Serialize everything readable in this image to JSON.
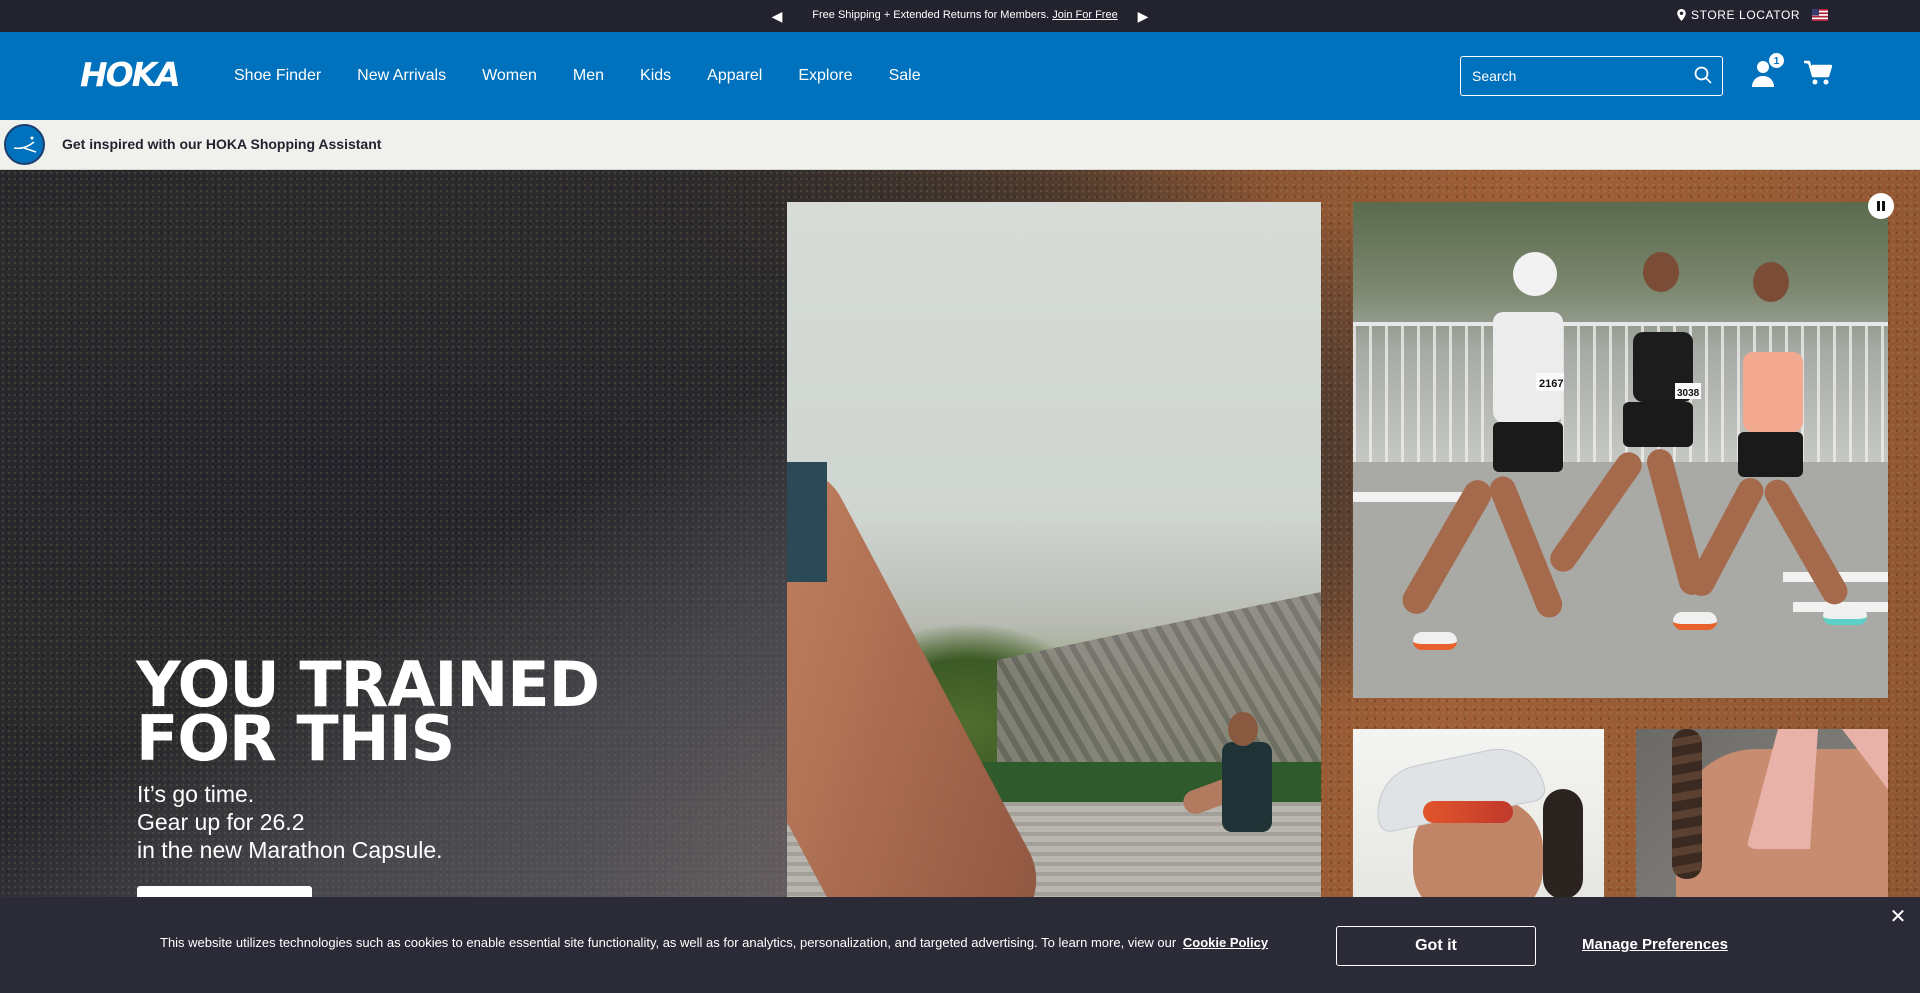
{
  "promo": {
    "prev_icon": "chevron-left-icon",
    "next_icon": "chevron-right-icon",
    "message": "Free Shipping + Extended Returns for Members.",
    "link": "Join For Free",
    "store_locator": "STORE LOCATOR",
    "flag_icon": "us-flag-icon"
  },
  "header": {
    "brand_color": "#0071bc",
    "logo_text": "HOKA",
    "nav": [
      "Shoe Finder",
      "New Arrivals",
      "Women",
      "Men",
      "Kids",
      "Apparel",
      "Explore",
      "Sale"
    ],
    "search_placeholder": "Search",
    "account_badge": "1"
  },
  "assistant": {
    "text": "Get inspired with our HOKA Shopping Assistant",
    "icon": "assistant-icon"
  },
  "hero": {
    "headline_line1": "YOU TRAINED",
    "headline_line2": "FOR THIS",
    "sub_line1": "It’s go time.",
    "sub_line2": "Gear up for 26.2",
    "sub_line3": "in the new Marathon Capsule.",
    "pause_icon": "pause-icon",
    "bib_numbers": [
      "2167",
      "3038"
    ]
  },
  "cookie": {
    "text": "This website utilizes technologies such as cookies to enable essential site functionality, as well as for analytics, personalization, and targeted advertising. To learn more, view our",
    "policy_link": "Cookie Policy",
    "accept": "Got it",
    "manage": "Manage Preferences",
    "close_icon": "close-icon"
  }
}
